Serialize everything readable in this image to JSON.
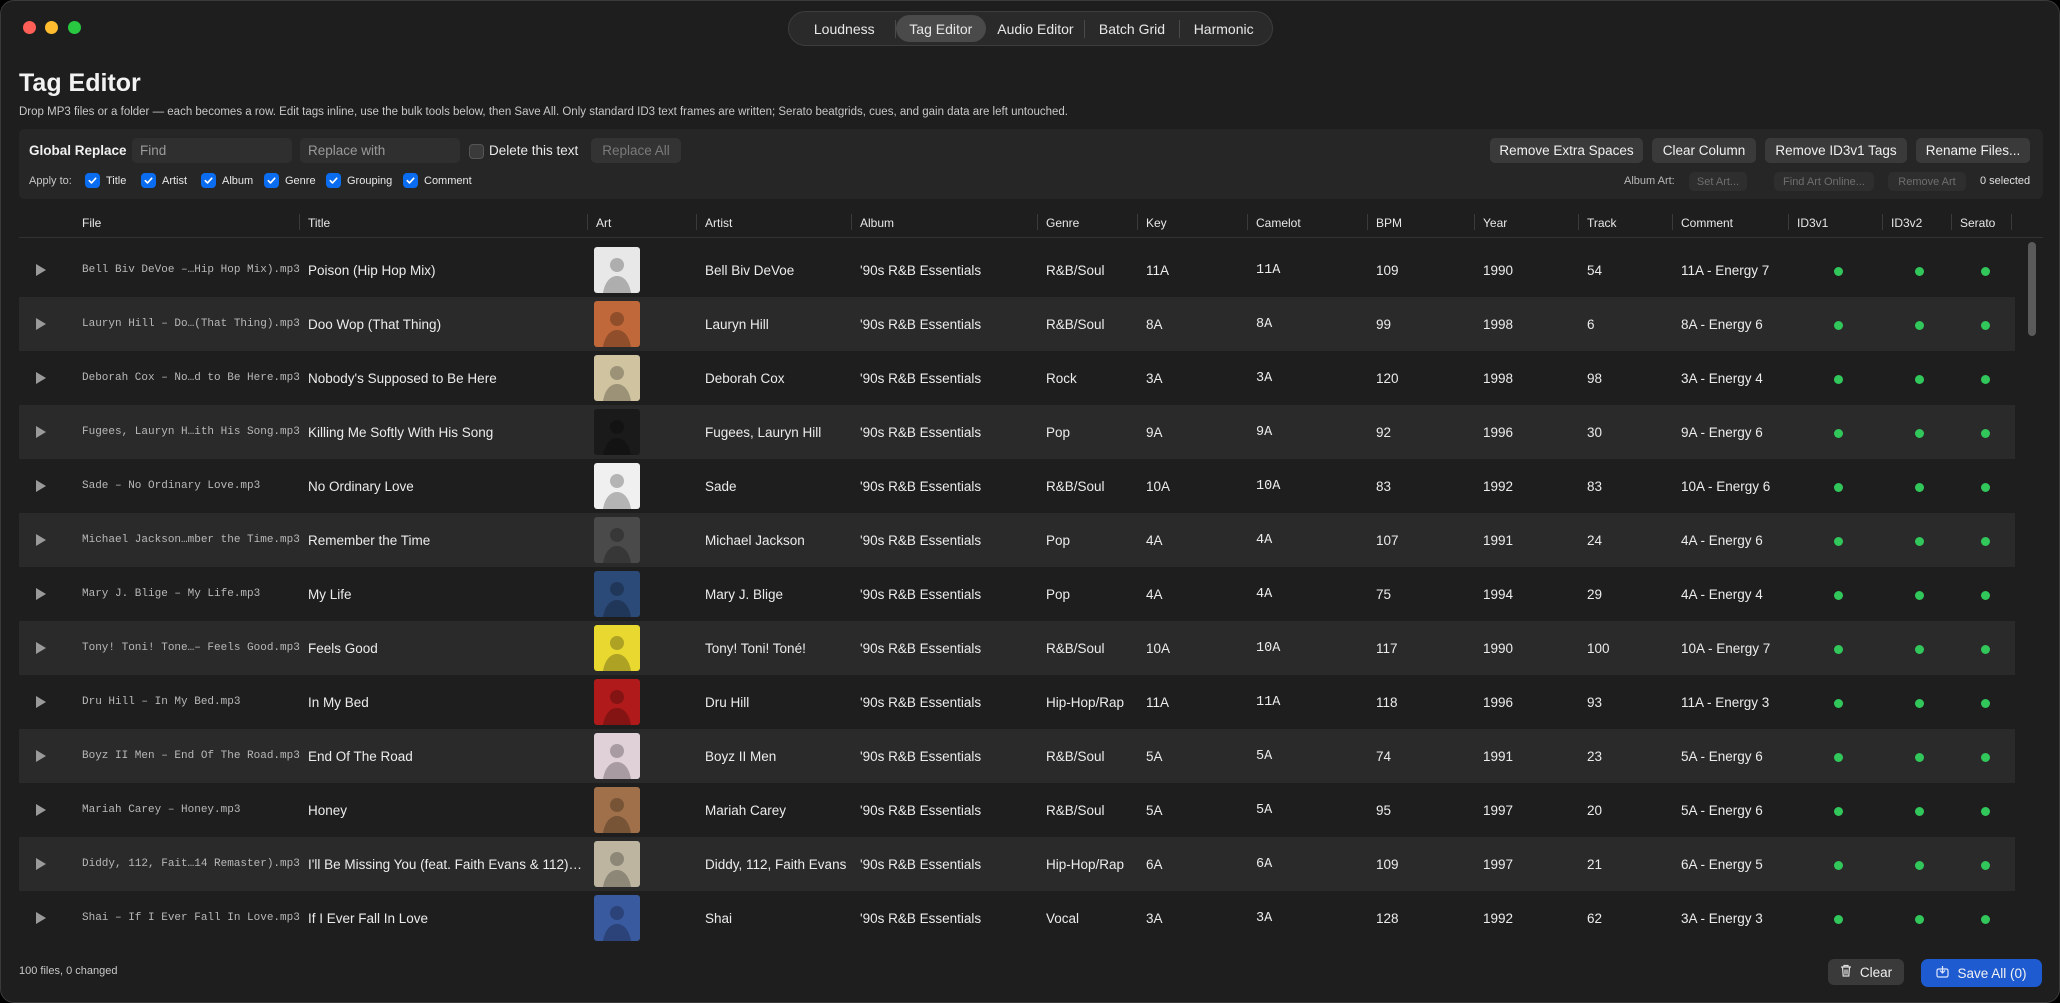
{
  "tabs": [
    {
      "label": "Loudness",
      "active": false
    },
    {
      "label": "Tag Editor",
      "active": true
    },
    {
      "label": "Audio Editor",
      "active": false
    },
    {
      "label": "Batch Grid",
      "active": false
    },
    {
      "label": "Harmonic",
      "active": false
    }
  ],
  "page": {
    "title": "Tag Editor",
    "subtitle": "Drop MP3 files or a folder — each becomes a row. Edit tags inline, use the bulk tools below, then Save All. Only standard ID3 text frames are written; Serato beatgrids, cues, and gain data are left untouched."
  },
  "toolbar": {
    "global_replace_label": "Global Replace",
    "find_placeholder": "Find",
    "replace_placeholder": "Replace with",
    "delete_text_label": "Delete this text",
    "replace_all_label": "Replace All",
    "remove_spaces_label": "Remove Extra Spaces",
    "clear_column_label": "Clear Column",
    "remove_id3v1_label": "Remove ID3v1 Tags",
    "rename_files_label": "Rename Files...",
    "apply_to_label": "Apply to:",
    "apply_fields": [
      "Title",
      "Artist",
      "Album",
      "Genre",
      "Grouping",
      "Comment"
    ],
    "album_art_label": "Album Art:",
    "set_art_label": "Set Art...",
    "find_art_label": "Find Art Online...",
    "remove_art_label": "Remove Art",
    "selected_label": "0 selected"
  },
  "columns": [
    "File",
    "Title",
    "Art",
    "Artist",
    "Album",
    "Genre",
    "Key",
    "Camelot",
    "BPM",
    "Year",
    "Track",
    "Comment",
    "ID3v1",
    "ID3v2",
    "Serato"
  ],
  "rows": [
    {
      "file": "Bell Biv DeVoe –…Hip Hop Mix).mp3",
      "title": "Poison (Hip Hop Mix)",
      "artist": "Bell Biv DeVoe",
      "album": "'90s R&B Essentials",
      "genre": "R&B/Soul",
      "key": "11A",
      "camelot": "11A",
      "bpm": "109",
      "year": "1990",
      "track": "54",
      "comment": "11A - Energy 7",
      "art_color": "#e8e8e8"
    },
    {
      "file": "Lauryn Hill – Do…(That Thing).mp3",
      "title": "Doo Wop (That Thing)",
      "artist": "Lauryn Hill",
      "album": "'90s R&B Essentials",
      "genre": "R&B/Soul",
      "key": "8A",
      "camelot": "8A",
      "bpm": "99",
      "year": "1998",
      "track": "6",
      "comment": "8A - Energy 6",
      "art_color": "#c0683a"
    },
    {
      "file": "Deborah Cox – No…d to Be Here.mp3",
      "title": "Nobody's Supposed to Be Here",
      "artist": "Deborah Cox",
      "album": "'90s R&B Essentials",
      "genre": "Rock",
      "key": "3A",
      "camelot": "3A",
      "bpm": "120",
      "year": "1998",
      "track": "98",
      "comment": "3A - Energy 4",
      "art_color": "#cfc3a0"
    },
    {
      "file": "Fugees, Lauryn H…ith His Song.mp3",
      "title": "Killing Me Softly With His Song",
      "artist": "Fugees, Lauryn Hill",
      "album": "'90s R&B Essentials",
      "genre": "Pop",
      "key": "9A",
      "camelot": "9A",
      "bpm": "92",
      "year": "1996",
      "track": "30",
      "comment": "9A - Energy 6",
      "art_color": "#1a1a1a"
    },
    {
      "file": "Sade – No Ordinary Love.mp3",
      "title": "No Ordinary Love",
      "artist": "Sade",
      "album": "'90s R&B Essentials",
      "genre": "R&B/Soul",
      "key": "10A",
      "camelot": "10A",
      "bpm": "83",
      "year": "1992",
      "track": "83",
      "comment": "10A - Energy 6",
      "art_color": "#f0f0f0"
    },
    {
      "file": "Michael Jackson…mber the Time.mp3",
      "title": "Remember the Time",
      "artist": "Michael Jackson",
      "album": "'90s R&B Essentials",
      "genre": "Pop",
      "key": "4A",
      "camelot": "4A",
      "bpm": "107",
      "year": "1991",
      "track": "24",
      "comment": "4A - Energy 6",
      "art_color": "#4a4a4a"
    },
    {
      "file": "Mary J. Blige – My Life.mp3",
      "title": "My Life",
      "artist": "Mary J. Blige",
      "album": "'90s R&B Essentials",
      "genre": "Pop",
      "key": "4A",
      "camelot": "4A",
      "bpm": "75",
      "year": "1994",
      "track": "29",
      "comment": "4A - Energy 4",
      "art_color": "#2b4a78"
    },
    {
      "file": "Tony! Toni! Tone…– Feels Good.mp3",
      "title": "Feels Good",
      "artist": "Tony! Toni! Toné!",
      "album": "'90s R&B Essentials",
      "genre": "R&B/Soul",
      "key": "10A",
      "camelot": "10A",
      "bpm": "117",
      "year": "1990",
      "track": "100",
      "comment": "10A - Energy 7",
      "art_color": "#e8d830"
    },
    {
      "file": "Dru Hill – In My Bed.mp3",
      "title": "In My Bed",
      "artist": "Dru Hill",
      "album": "'90s R&B Essentials",
      "genre": "Hip-Hop/Rap",
      "key": "11A",
      "camelot": "11A",
      "bpm": "118",
      "year": "1996",
      "track": "93",
      "comment": "11A - Energy 3",
      "art_color": "#b01a1a"
    },
    {
      "file": "Boyz II Men – End Of The Road.mp3",
      "title": "End Of The Road",
      "artist": "Boyz II Men",
      "album": "'90s R&B Essentials",
      "genre": "R&B/Soul",
      "key": "5A",
      "camelot": "5A",
      "bpm": "74",
      "year": "1991",
      "track": "23",
      "comment": "5A - Energy 6",
      "art_color": "#e0d0d8"
    },
    {
      "file": "Mariah Carey – Honey.mp3",
      "title": "Honey",
      "artist": "Mariah Carey",
      "album": "'90s R&B Essentials",
      "genre": "R&B/Soul",
      "key": "5A",
      "camelot": "5A",
      "bpm": "95",
      "year": "1997",
      "track": "20",
      "comment": "5A - Energy 6",
      "art_color": "#a0704a"
    },
    {
      "file": "Diddy, 112, Fait…14 Remaster).mp3",
      "title": "I'll Be Missing You (feat. Faith Evans & 112)…",
      "artist": "Diddy, 112, Faith Evans",
      "album": "'90s R&B Essentials",
      "genre": "Hip-Hop/Rap",
      "key": "6A",
      "camelot": "6A",
      "bpm": "109",
      "year": "1997",
      "track": "21",
      "comment": "6A - Energy 5",
      "art_color": "#bdb5a0"
    },
    {
      "file": "Shai – If I Ever Fall In Love.mp3",
      "title": "If I Ever Fall In Love",
      "artist": "Shai",
      "album": "'90s R&B Essentials",
      "genre": "Vocal",
      "key": "3A",
      "camelot": "3A",
      "bpm": "128",
      "year": "1992",
      "track": "62",
      "comment": "3A - Energy 3",
      "art_color": "#3a5aa0"
    }
  ],
  "footer": {
    "status": "100 files, 0 changed",
    "clear_label": "Clear",
    "save_all_label": "Save All (0)"
  },
  "colors": {
    "accent": "#0a6cf0",
    "save": "#1f5bd0",
    "status_ok": "#31c75a"
  }
}
